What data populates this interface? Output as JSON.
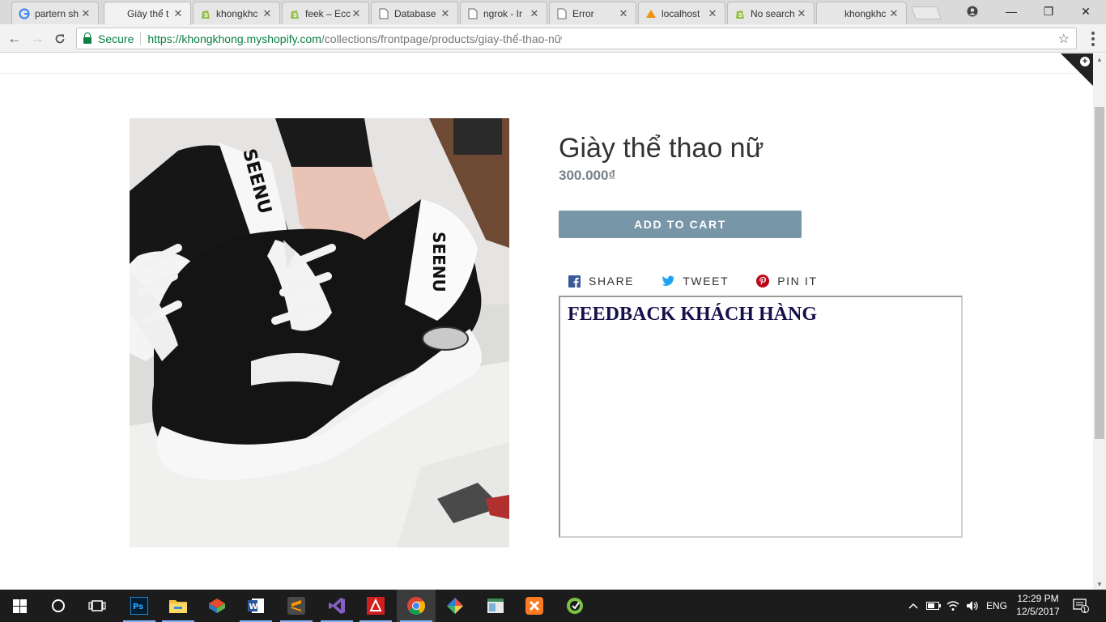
{
  "browser": {
    "tabs": [
      {
        "title": "partern sh",
        "icon": "google-icon"
      },
      {
        "title": "Giày thể t",
        "icon": "none",
        "active": true
      },
      {
        "title": "khongkhc",
        "icon": "shopify-icon"
      },
      {
        "title": "feek – Ecc",
        "icon": "shopify-icon"
      },
      {
        "title": "Database",
        "icon": "page-icon"
      },
      {
        "title": "ngrok - Ir",
        "icon": "page-icon"
      },
      {
        "title": "Error",
        "icon": "page-icon"
      },
      {
        "title": "localhost",
        "icon": "phpmyadmin-icon"
      },
      {
        "title": "No search",
        "icon": "shopify-icon"
      },
      {
        "title": "khongkhc",
        "icon": "none"
      }
    ],
    "secure_label": "Secure",
    "url_host": "https://khongkhong.myshopify.com",
    "url_path": "/collections/frontpage/products/giay-thể-thao-nữ"
  },
  "product": {
    "title": "Giày thể thao nữ",
    "price": "300.000₫",
    "add_to_cart": "ADD TO CART",
    "share": {
      "facebook": "SHARE",
      "twitter": "TWEET",
      "pinterest": "PIN IT"
    },
    "feedback_title": "FEEDBACK KHÁCH HÀNG",
    "image_brand_text": "SEENU"
  },
  "taskbar": {
    "apps": [
      "windows-start-icon",
      "cortana-icon",
      "task-view-icon",
      "photoshop-icon",
      "file-explorer-icon",
      "sketchup-icon",
      "word-icon",
      "sublime-icon",
      "visual-studio-icon",
      "acrobat-icon",
      "chrome-icon",
      "sourcetree-icon",
      "app-icon",
      "xampp-icon",
      "app-green-icon"
    ],
    "language": "ENG",
    "time": "12:29 PM",
    "date": "12/5/2017",
    "notification_count": "1"
  },
  "colors": {
    "button": "#7796a8",
    "price": "#788188",
    "feedback_title": "#16104a",
    "secure": "#0b8043",
    "facebook": "#3b5998",
    "twitter": "#1da1f2",
    "pinterest": "#bd081c"
  }
}
